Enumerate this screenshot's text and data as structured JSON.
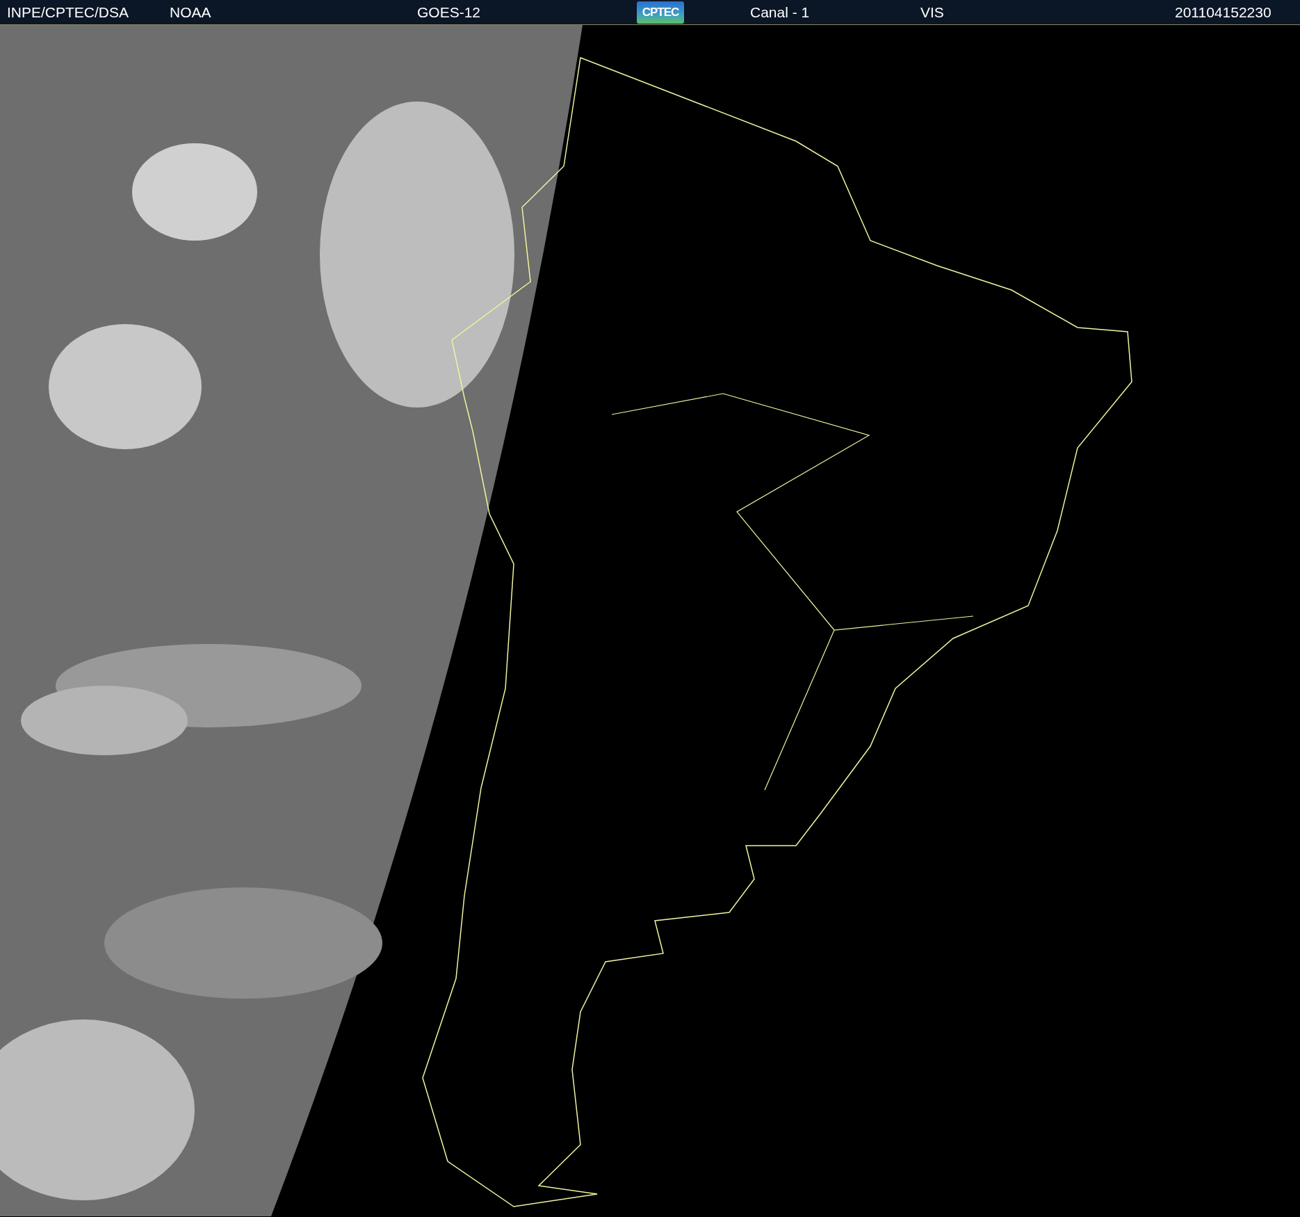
{
  "header": {
    "items": [
      {
        "kind": "text",
        "text": "INPE/CPTEC/DSA"
      },
      {
        "kind": "text",
        "text": "NOAA"
      },
      {
        "kind": "text",
        "text": "GOES-12"
      },
      {
        "kind": "logo",
        "text": "CPTEC"
      },
      {
        "kind": "text",
        "text": "Canal - 1"
      },
      {
        "kind": "text",
        "text": "VIS"
      },
      {
        "kind": "text",
        "text": "201104152230"
      }
    ]
  }
}
